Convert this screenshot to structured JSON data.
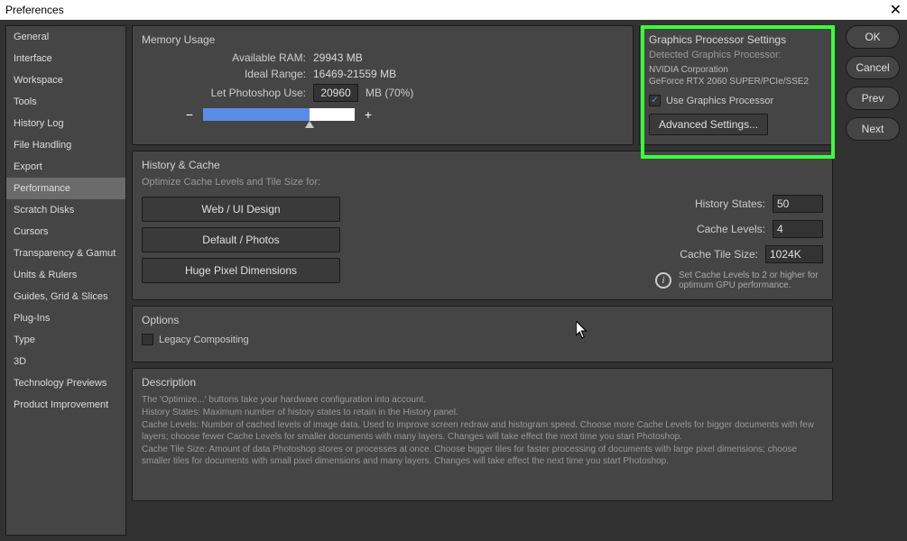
{
  "titlebar": {
    "title": "Preferences"
  },
  "sidebar": {
    "items": [
      {
        "label": "General"
      },
      {
        "label": "Interface"
      },
      {
        "label": "Workspace"
      },
      {
        "label": "Tools"
      },
      {
        "label": "History Log"
      },
      {
        "label": "File Handling"
      },
      {
        "label": "Export"
      },
      {
        "label": "Performance",
        "selected": true
      },
      {
        "label": "Scratch Disks"
      },
      {
        "label": "Cursors"
      },
      {
        "label": "Transparency & Gamut"
      },
      {
        "label": "Units & Rulers"
      },
      {
        "label": "Guides, Grid & Slices"
      },
      {
        "label": "Plug-Ins"
      },
      {
        "label": "Type"
      },
      {
        "label": "3D"
      },
      {
        "label": "Technology Previews"
      },
      {
        "label": "Product Improvement"
      }
    ]
  },
  "buttons": {
    "ok": "OK",
    "cancel": "Cancel",
    "prev": "Prev",
    "next": "Next"
  },
  "memory": {
    "title": "Memory Usage",
    "available_ram_label": "Available RAM:",
    "available_ram_value": "29943 MB",
    "ideal_range_label": "Ideal Range:",
    "ideal_range_value": "16469-21559 MB",
    "let_use_label": "Let Photoshop Use:",
    "let_use_value": "20960",
    "let_use_suffix": "MB (70%)",
    "minus": "−",
    "plus": "+"
  },
  "gpu": {
    "title": "Graphics Processor Settings",
    "detected_label": "Detected Graphics Processor:",
    "vendor": "NVIDIA Corporation",
    "model": "GeForce RTX 2060 SUPER/PCIe/SSE2",
    "use_checkbox_label": "Use Graphics Processor",
    "use_checked": true,
    "advanced_btn": "Advanced Settings..."
  },
  "history": {
    "title": "History & Cache",
    "optimize_label": "Optimize Cache Levels and Tile Size for:",
    "btn_web": "Web / UI Design",
    "btn_default": "Default / Photos",
    "btn_huge": "Huge Pixel Dimensions",
    "history_states_label": "History States:",
    "history_states_value": "50",
    "cache_levels_label": "Cache Levels:",
    "cache_levels_value": "4",
    "cache_tile_label": "Cache Tile Size:",
    "cache_tile_value": "1024K",
    "hint": "Set Cache Levels to 2 or higher for optimum GPU performance."
  },
  "options": {
    "title": "Options",
    "legacy_label": "Legacy Compositing",
    "legacy_checked": false
  },
  "description": {
    "title": "Description",
    "lines": [
      "The 'Optimize...' buttons take your hardware configuration into account.",
      "History States: Maximum number of history states to retain in the History panel.",
      "Cache Levels: Number of cached levels of image data.  Used to improve screen redraw and histogram speed.  Choose more Cache Levels for bigger documents with few layers; choose fewer Cache Levels for smaller documents with many layers. Changes will take effect the next time you start Photoshop.",
      "Cache Tile Size: Amount of data Photoshop stores or processes at once. Choose bigger tiles for faster processing of documents with large pixel dimensions; choose smaller tiles for documents with small pixel dimensions and many layers. Changes will take effect the next time you start Photoshop."
    ]
  }
}
